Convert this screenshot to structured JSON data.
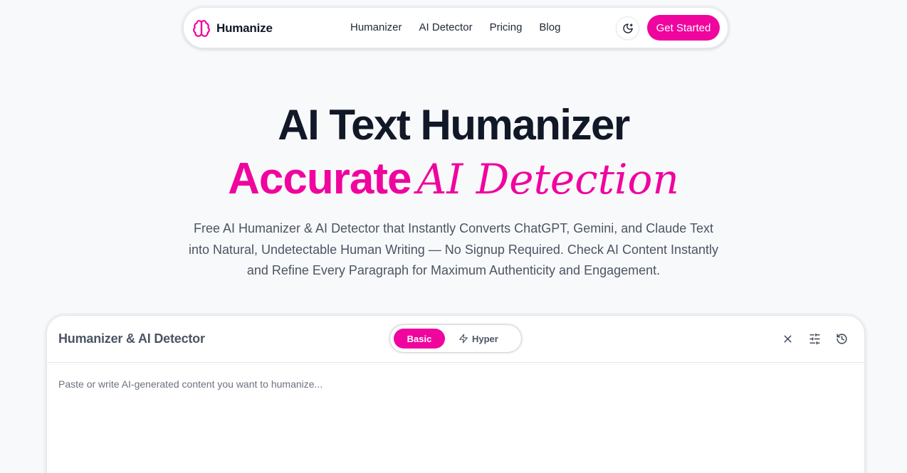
{
  "brand": {
    "name": "Humanize",
    "logo_icon": "brain-icon",
    "accent": "#f0049e"
  },
  "nav": {
    "links": [
      "Humanizer",
      "AI Detector",
      "Pricing",
      "Blog"
    ],
    "theme_toggle_icon": "moon-icon",
    "cta_label": "Get Started"
  },
  "hero": {
    "title": "AI Text Humanizer",
    "subtitle_accent": "Accurate",
    "subtitle_italic": "AI Detection",
    "description": "Free AI Humanizer & AI Detector that Instantly Converts ChatGPT, Gemini, and Claude Text into Natural, Undetectable Human Writing — No Signup Required. Check AI Content Instantly and Refine Every Paragraph for Maximum Authenticity and Engagement."
  },
  "tool": {
    "title": "Humanizer & AI Detector",
    "modes": {
      "basic": "Basic",
      "hyper": "Hyper",
      "selected": "Basic"
    },
    "actions": [
      "close-icon",
      "sliders-icon",
      "history-icon"
    ],
    "editor": {
      "value": "",
      "placeholder": "Paste or write AI-generated content you want to humanize..."
    }
  }
}
